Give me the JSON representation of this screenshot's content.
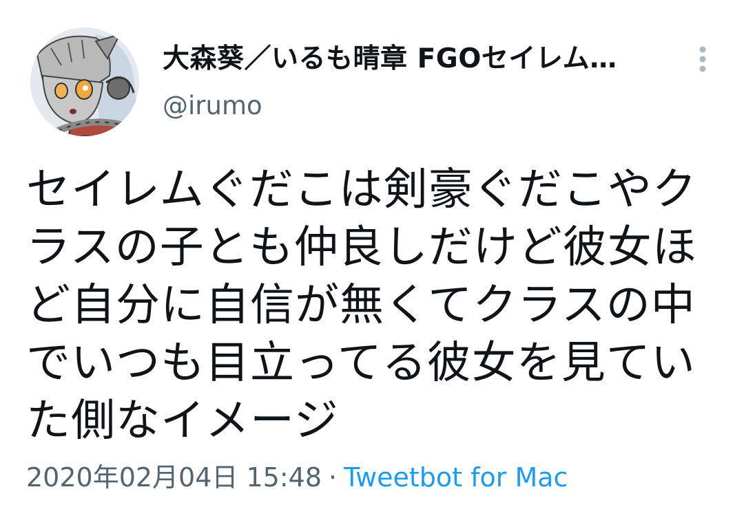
{
  "tweet": {
    "author": {
      "display_name": "大森葵／いるも晴章 FGOセイレム…",
      "handle": "@irumo",
      "avatar_icon": "character-avatar"
    },
    "more_icon": "more-vertical-icon",
    "text": "セイレムぐだこは剣豪ぐだこやクラスの子とも仲良しだけど彼女ほど自分に自信が無くてクラスの中でいつも目立ってる彼女を見ていた側なイメージ",
    "timestamp": "2020年02月04日 15:48",
    "separator": "·",
    "source": "Tweetbot for Mac"
  },
  "colors": {
    "text": "#0f1419",
    "secondary": "#536471",
    "link": "#1d9bf0",
    "more_dots": "#aab8c2"
  }
}
